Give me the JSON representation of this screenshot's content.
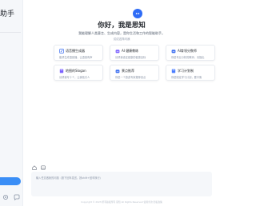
{
  "sidebar": {
    "brand": "助手"
  },
  "welcome": {
    "greeting": "你好，我是思知",
    "subtitle": "我能理解人类意言、生成内容，是你生活和工作的智能助手。",
    "hint": "试试这样问我"
  },
  "cards": [
    {
      "title": "语音播生成器",
      "desc": "能帮生成语音播，让语音有声",
      "icon": "edit-icon",
      "color": "#3a6df0"
    },
    {
      "title": "AI 健康教练",
      "desc": "请帮我设定健康的健康目标",
      "icon": "robot-icon",
      "color": "#7b61ff"
    },
    {
      "title": "AI育领分数师",
      "desc": "你是专业分析的教师，请指出",
      "icon": "robot-icon",
      "color": "#3a6df0"
    },
    {
      "title": "地图的Slogan",
      "desc": "请帮我写十个，让我吸引人",
      "icon": "book-icon",
      "color": "#7b61ff"
    },
    {
      "title": "景点推荐",
      "desc": "你是一个旅游专家推荐景点",
      "icon": "robot-icon",
      "color": "#3a6df0"
    },
    {
      "title": "学习计划制",
      "desc": "你是制定学习计划，要平衡",
      "icon": "book-icon",
      "color": "#4a7dff"
    }
  ],
  "input": {
    "placeholder": "输入任意做我的问题（按下回车发送，按shift+回车换行）"
  },
  "footer": "Copyright © 2023 所有版权所有 思知 All Rights Reserved 使用条款 隐私政策",
  "colors": {
    "accent": "#3a8ef6",
    "logo": "#2f6cf6"
  }
}
